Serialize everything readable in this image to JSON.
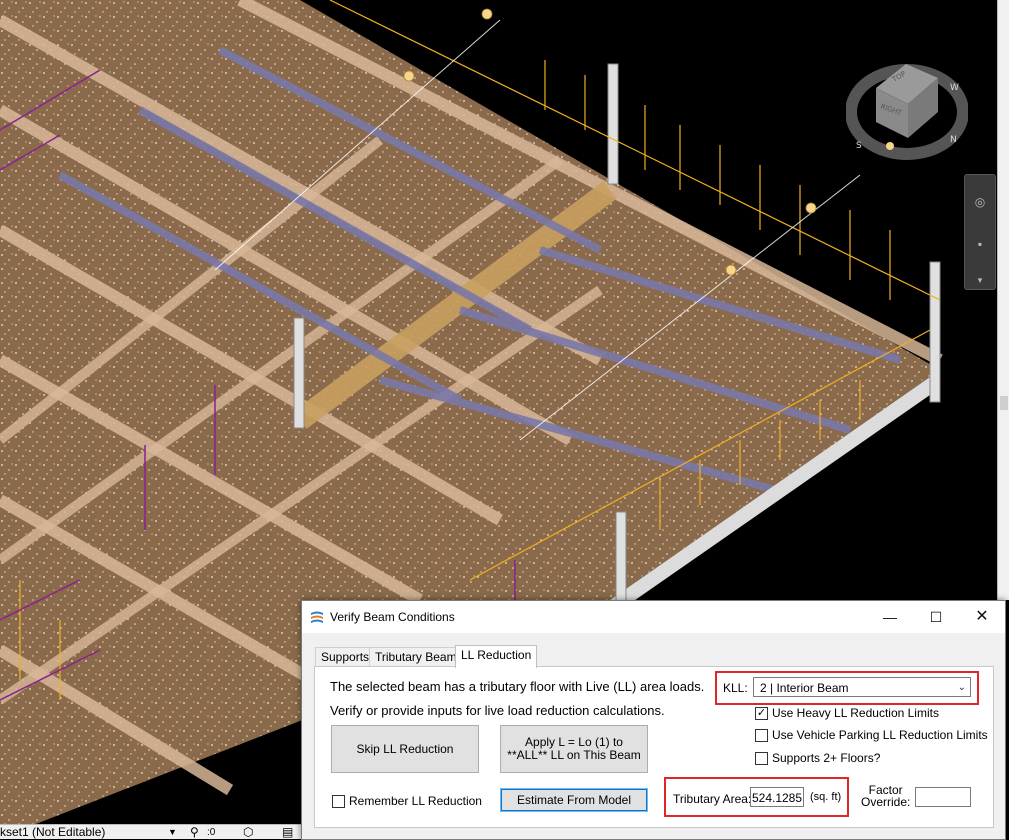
{
  "status_bar": {
    "workset": "kset1 (Not Editable)",
    "filter_count": ":0"
  },
  "dialog": {
    "title": "Verify Beam Conditions",
    "window_controls": {
      "minimize": "—",
      "maximize": "☐",
      "close": "✕"
    },
    "tabs": [
      {
        "label": "Supports",
        "active": false
      },
      {
        "label": "Tributary Beams",
        "active": false
      },
      {
        "label": "LL Reduction",
        "active": true
      }
    ],
    "description_line1": "The selected beam has a tributary floor with Live (LL) area loads.",
    "description_line2": "Verify or provide inputs for live load reduction calculations.",
    "kll": {
      "label": "KLL:",
      "value": "2 | Interior Beam"
    },
    "checkboxes": {
      "heavy": {
        "label": "Use Heavy LL Reduction Limits",
        "checked": true
      },
      "vehicle": {
        "label": "Use Vehicle Parking LL Reduction Limits",
        "checked": false
      },
      "floors": {
        "label": "Supports 2+ Floors?",
        "checked": false
      },
      "remember": {
        "label": "Remember LL Reduction",
        "checked": false
      }
    },
    "buttons": {
      "skip": "Skip LL Reduction",
      "apply_line1": "Apply L = Lo (1) to",
      "apply_line2": "**ALL** LL on This Beam",
      "estimate": "Estimate From Model"
    },
    "tributary_area": {
      "label": "Tributary Area:",
      "value": "524.1285",
      "unit": "(sq. ft)"
    },
    "factor_override": {
      "label_line1": "Factor",
      "label_line2": "Override:",
      "value": ""
    }
  },
  "colors": {
    "highlight_border": "#e0252b",
    "floor": "#8a6a4a",
    "beam": "#d8b898",
    "selected_beam": "#c9a060",
    "load_line_yellow": "#f0b020",
    "load_line_purple": "#8a2090"
  }
}
